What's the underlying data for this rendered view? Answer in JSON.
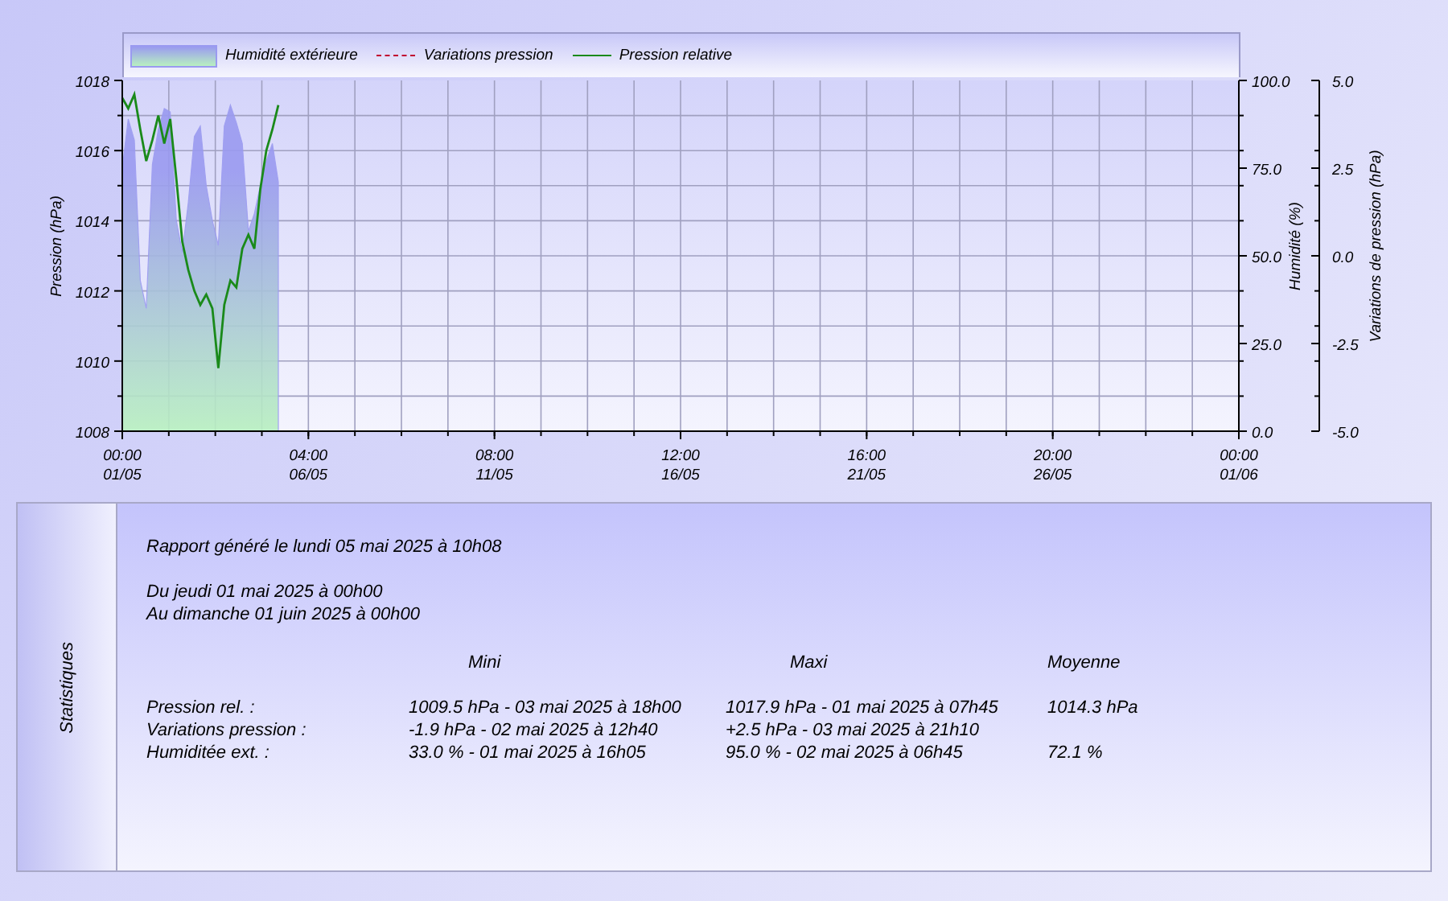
{
  "chart": {
    "extra_legend": {
      "name": "Variations pression",
      "color": "#c00030"
    },
    "variation_axis": {
      "label": "Variations de pression (hPa)",
      "ticks": [
        "5.0",
        "2.5",
        "0.0",
        "-2.5",
        "-5.0"
      ]
    },
    "chart_data": {
      "type": "line",
      "grid": true,
      "categories": [
        "00:00\n01/05",
        null,
        null,
        null,
        null,
        null,
        null,
        null,
        null,
        null,
        null,
        null,
        null,
        null,
        null,
        null,
        null,
        null,
        null,
        null,
        null,
        null,
        null,
        null,
        null,
        null,
        null,
        null,
        null,
        null,
        null,
        "04:00\n06/05",
        null,
        null,
        null,
        null,
        null,
        null,
        null,
        null,
        null,
        null,
        null,
        null,
        null,
        null,
        null,
        null,
        null,
        null,
        null,
        null,
        null,
        null,
        null,
        null,
        null,
        null,
        null,
        null,
        null,
        null,
        "08:00\n11/05",
        null,
        null,
        null,
        null,
        null,
        null,
        null,
        null,
        null,
        null,
        null,
        null,
        null,
        null,
        null,
        null,
        null,
        null,
        null,
        null,
        null,
        null,
        null,
        null,
        null,
        null,
        null,
        null,
        null,
        null,
        "12:00\n16/05",
        null,
        null,
        null,
        null,
        null,
        null,
        null,
        null,
        null,
        null,
        null,
        null,
        null,
        null,
        null,
        null,
        null,
        null,
        null,
        null,
        null,
        null,
        null,
        null,
        null,
        null,
        null,
        null,
        null,
        null,
        "16:00\n21/05",
        null,
        null,
        null,
        null,
        null,
        null,
        null,
        null,
        null,
        null,
        null,
        null,
        null,
        null,
        null,
        null,
        null,
        null,
        null,
        null,
        null,
        null,
        null,
        null,
        null,
        null,
        null,
        null,
        null,
        null,
        "20:00\n26/05",
        null,
        null,
        null,
        null,
        null,
        null,
        null,
        null,
        null,
        null,
        null,
        null,
        null,
        null,
        null,
        null,
        null,
        null,
        null,
        null,
        null,
        null,
        null,
        null,
        null,
        null,
        null,
        null,
        null,
        null,
        "00:00\n01/06"
      ],
      "ylabel": "Pression (hPa)",
      "ylim": [
        1008,
        1018
      ],
      "yticks": [
        1008,
        1010,
        1012,
        1014,
        1016,
        1018
      ],
      "y2label": "Humidité (%)",
      "y2lim": [
        0,
        100
      ],
      "y2ticks": [
        {
          "value": 0,
          "label": "0.0"
        },
        {
          "value": 25,
          "label": "25.0"
        },
        {
          "value": 50,
          "label": "50.0"
        },
        {
          "value": 75,
          "label": "75.0"
        },
        {
          "value": 100,
          "label": "100.0"
        }
      ],
      "series": [
        {
          "name": "Humidité extérieure",
          "type": "area",
          "axis": "y2",
          "color": "#9a9af0",
          "values": [
            75,
            89,
            83,
            43,
            35,
            76,
            86,
            92,
            91,
            60,
            51,
            65,
            84,
            87,
            70,
            60,
            53,
            87,
            93,
            88,
            82,
            57,
            62,
            70,
            77,
            82,
            71,
            null,
            null,
            null,
            null,
            null,
            null,
            null,
            null,
            null,
            null,
            null,
            null,
            null,
            null,
            null,
            null,
            null,
            null,
            null,
            null,
            null,
            null,
            null,
            null,
            null,
            null,
            null,
            null,
            null,
            null,
            null,
            null,
            null,
            null,
            null,
            null,
            null,
            null,
            null,
            null,
            null,
            null,
            null,
            null,
            null,
            null,
            null,
            null,
            null,
            null,
            null,
            null,
            null,
            null,
            null,
            null,
            null,
            null,
            null,
            null,
            null,
            null,
            null,
            null,
            null,
            null,
            null,
            null,
            null,
            null,
            null,
            null,
            null,
            null,
            null,
            null,
            null,
            null,
            null,
            null,
            null,
            null,
            null,
            null,
            null,
            null,
            null,
            null,
            null,
            null,
            null,
            null,
            null,
            null,
            null,
            null,
            null,
            null,
            null,
            null,
            null,
            null,
            null,
            null,
            null,
            null,
            null,
            null,
            null,
            null,
            null,
            null,
            null,
            null,
            null,
            null,
            null,
            null,
            null,
            null,
            null,
            null,
            null,
            null,
            null,
            null,
            null,
            null,
            null,
            null,
            null,
            null,
            null,
            null,
            null,
            null,
            null,
            null,
            null,
            null,
            null,
            null,
            null,
            null,
            null,
            null,
            null,
            null,
            null,
            null,
            null,
            null,
            null,
            null,
            null,
            null,
            null,
            null,
            null,
            null
          ]
        },
        {
          "name": "Pression relative",
          "type": "line",
          "color": "#1a8a1a",
          "values": [
            1017.5,
            1017.2,
            1017.6,
            1016.6,
            1015.7,
            1016.3,
            1017.0,
            1016.2,
            1016.9,
            1015.2,
            1013.4,
            1012.6,
            1012.0,
            1011.6,
            1011.9,
            1011.5,
            1009.8,
            1011.6,
            1012.3,
            1012.1,
            1013.2,
            1013.6,
            1013.2,
            1014.9,
            1016.0,
            1016.6,
            1017.3,
            null,
            null,
            null,
            null,
            null,
            null,
            null,
            null,
            null,
            null,
            null,
            null,
            null,
            null,
            null,
            null,
            null,
            null,
            null,
            null,
            null,
            null,
            null,
            null,
            null,
            null,
            null,
            null,
            null,
            null,
            null,
            null,
            null,
            null,
            null,
            null,
            null,
            null,
            null,
            null,
            null,
            null,
            null,
            null,
            null,
            null,
            null,
            null,
            null,
            null,
            null,
            null,
            null,
            null,
            null,
            null,
            null,
            null,
            null,
            null,
            null,
            null,
            null,
            null,
            null,
            null,
            null,
            null,
            null,
            null,
            null,
            null,
            null,
            null,
            null,
            null,
            null,
            null,
            null,
            null,
            null,
            null,
            null,
            null,
            null,
            null,
            null,
            null,
            null,
            null,
            null,
            null,
            null,
            null,
            null,
            null,
            null,
            null,
            null,
            null,
            null,
            null,
            null,
            null,
            null,
            null,
            null,
            null,
            null,
            null,
            null,
            null,
            null,
            null,
            null,
            null,
            null,
            null,
            null,
            null,
            null,
            null,
            null,
            null,
            null,
            null,
            null,
            null,
            null,
            null,
            null,
            null,
            null,
            null,
            null,
            null,
            null,
            null,
            null,
            null,
            null,
            null,
            null,
            null,
            null,
            null,
            null,
            null,
            null,
            null,
            null,
            null,
            null,
            null,
            null,
            null,
            null,
            null,
            null,
            null
          ]
        }
      ]
    }
  },
  "stats": {
    "tab_label": "Statistiques",
    "generated": "Rapport généré le lundi 05 mai 2025 à 10h08",
    "from": "Du jeudi 01 mai 2025 à 00h00",
    "to": "Au dimanche 01 juin 2025 à 00h00",
    "columns": [
      "Mini",
      "Maxi",
      "Moyenne"
    ],
    "rows": [
      {
        "label": "Pression rel. :",
        "mini": "1009.5 hPa - 03 mai 2025 à 18h00",
        "maxi": "1017.9 hPa - 01 mai 2025 à 07h45",
        "moyenne": "1014.3 hPa"
      },
      {
        "label": "Variations pression :",
        "mini": "-1.9 hPa - 02 mai 2025 à 12h40",
        "maxi": "+2.5 hPa - 03 mai 2025 à 21h10"
      },
      {
        "label": "Humiditée ext. :",
        "mini": "33.0 % - 01 mai 2025 à 16h05",
        "maxi": "95.0 % - 02 mai 2025 à 06h45",
        "moyenne": "72.1 %"
      }
    ]
  }
}
